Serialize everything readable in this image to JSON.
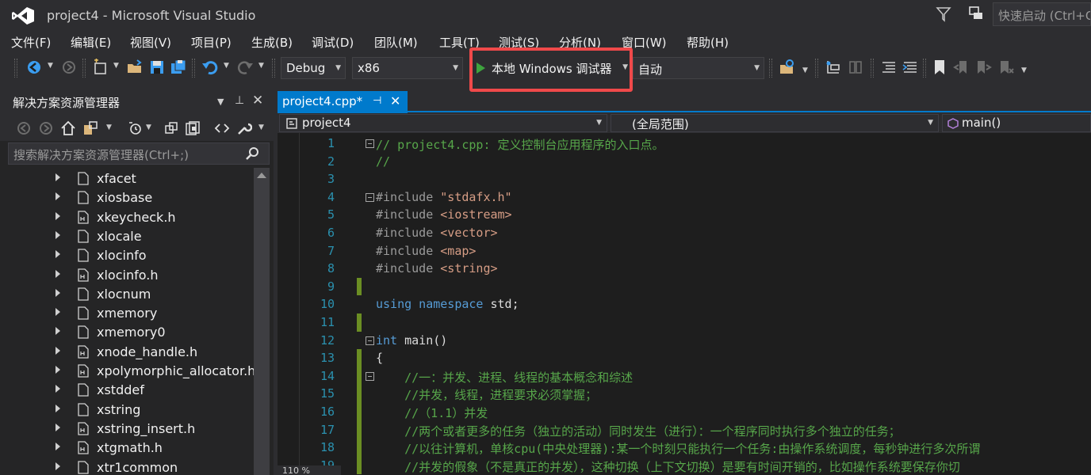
{
  "window": {
    "title": "project4 - Microsoft Visual Studio",
    "quick_launch_placeholder": "快速启动 (Ctrl+Q)"
  },
  "menu": [
    "文件(F)",
    "编辑(E)",
    "视图(V)",
    "项目(P)",
    "生成(B)",
    "调试(D)",
    "团队(M)",
    "工具(T)",
    "测试(S)",
    "分析(N)",
    "窗口(W)",
    "帮助(H)"
  ],
  "toolbar": {
    "configuration": "Debug",
    "platform": "x86",
    "debugger": "本地 Windows 调试器",
    "solution_config": "自动"
  },
  "solution_explorer": {
    "title": "解决方案资源管理器",
    "search_placeholder": "搜索解决方案资源管理器(Ctrl+;)",
    "items": [
      {
        "name": "xfacet",
        "kind": "file"
      },
      {
        "name": "xiosbase",
        "kind": "file"
      },
      {
        "name": "xkeycheck.h",
        "kind": "header"
      },
      {
        "name": "xlocale",
        "kind": "file"
      },
      {
        "name": "xlocinfo",
        "kind": "file"
      },
      {
        "name": "xlocinfo.h",
        "kind": "header"
      },
      {
        "name": "xlocnum",
        "kind": "file"
      },
      {
        "name": "xmemory",
        "kind": "file"
      },
      {
        "name": "xmemory0",
        "kind": "file"
      },
      {
        "name": "xnode_handle.h",
        "kind": "header"
      },
      {
        "name": "xpolymorphic_allocator.h",
        "kind": "header"
      },
      {
        "name": "xstddef",
        "kind": "file"
      },
      {
        "name": "xstring",
        "kind": "file"
      },
      {
        "name": "xstring_insert.h",
        "kind": "header"
      },
      {
        "name": "xtgmath.h",
        "kind": "header"
      },
      {
        "name": "xtr1common",
        "kind": "file"
      }
    ]
  },
  "editor": {
    "tab_label": "project4.cpp*",
    "nav_project": "project4",
    "nav_scope": "(全局范围)",
    "nav_member": "main()",
    "zoom": "110 %",
    "lines": [
      {
        "n": "1",
        "text": "// project4.cpp: 定义控制台应用程序的入口点。"
      },
      {
        "n": "2",
        "text": "//"
      },
      {
        "n": "3",
        "text": ""
      },
      {
        "n": "4",
        "text": "#include \"stdafx.h\""
      },
      {
        "n": "5",
        "text": "#include <iostream>"
      },
      {
        "n": "6",
        "text": "#include <vector>"
      },
      {
        "n": "7",
        "text": "#include <map>"
      },
      {
        "n": "8",
        "text": "#include <string>"
      },
      {
        "n": "9",
        "text": ""
      },
      {
        "n": "10",
        "text": "using namespace std;"
      },
      {
        "n": "11",
        "text": ""
      },
      {
        "n": "12",
        "text": "int main()"
      },
      {
        "n": "13",
        "text": "{"
      },
      {
        "n": "14",
        "text": "    //一：并发、进程、线程的基本概念和综述"
      },
      {
        "n": "15",
        "text": "    //并发，线程，进程要求必须掌握；"
      },
      {
        "n": "16",
        "text": "    //（1.1）并发"
      },
      {
        "n": "17",
        "text": "    //两个或者更多的任务（独立的活动）同时发生（进行）：一个程序同时执行多个独立的任务；"
      },
      {
        "n": "18",
        "text": "    //以往计算机，单核cpu(中央处理器):某一个时刻只能执行一个任务:由操作系统调度，每秒钟进行多次所谓"
      },
      {
        "n": "19",
        "text": "    //并发的假象（不是真正的并发），这种切换（上下文切换）是要有时间开销的，比如操作系统要保存你切"
      }
    ]
  },
  "colors": {
    "accent": "#007acc",
    "highlight": "#f0494a",
    "change_bar": "#6b8e23"
  }
}
